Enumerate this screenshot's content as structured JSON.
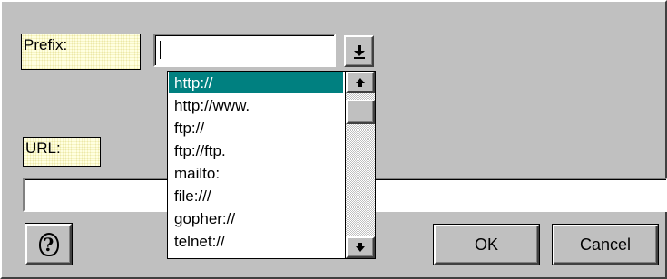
{
  "prefix": {
    "label": "Prefix:",
    "value": ""
  },
  "url": {
    "label": "URL:",
    "value": ""
  },
  "dropdown": {
    "items": [
      "http://",
      "http://www.",
      "ftp://",
      "ftp://ftp.",
      "mailto:",
      "file:///",
      "gopher://",
      "telnet://"
    ],
    "selected_index": 0
  },
  "buttons": {
    "help_glyph": "?",
    "ok": "OK",
    "cancel": "Cancel"
  },
  "colors": {
    "face": "#c0c0c0",
    "selection": "#008080",
    "label_bg": "#ffffe0"
  },
  "icons": {
    "dropdown_arrow": "dropdown-arrow-icon",
    "scroll_up": "scroll-up-arrow-icon",
    "scroll_down": "scroll-down-arrow-icon",
    "help": "help-question-icon"
  }
}
